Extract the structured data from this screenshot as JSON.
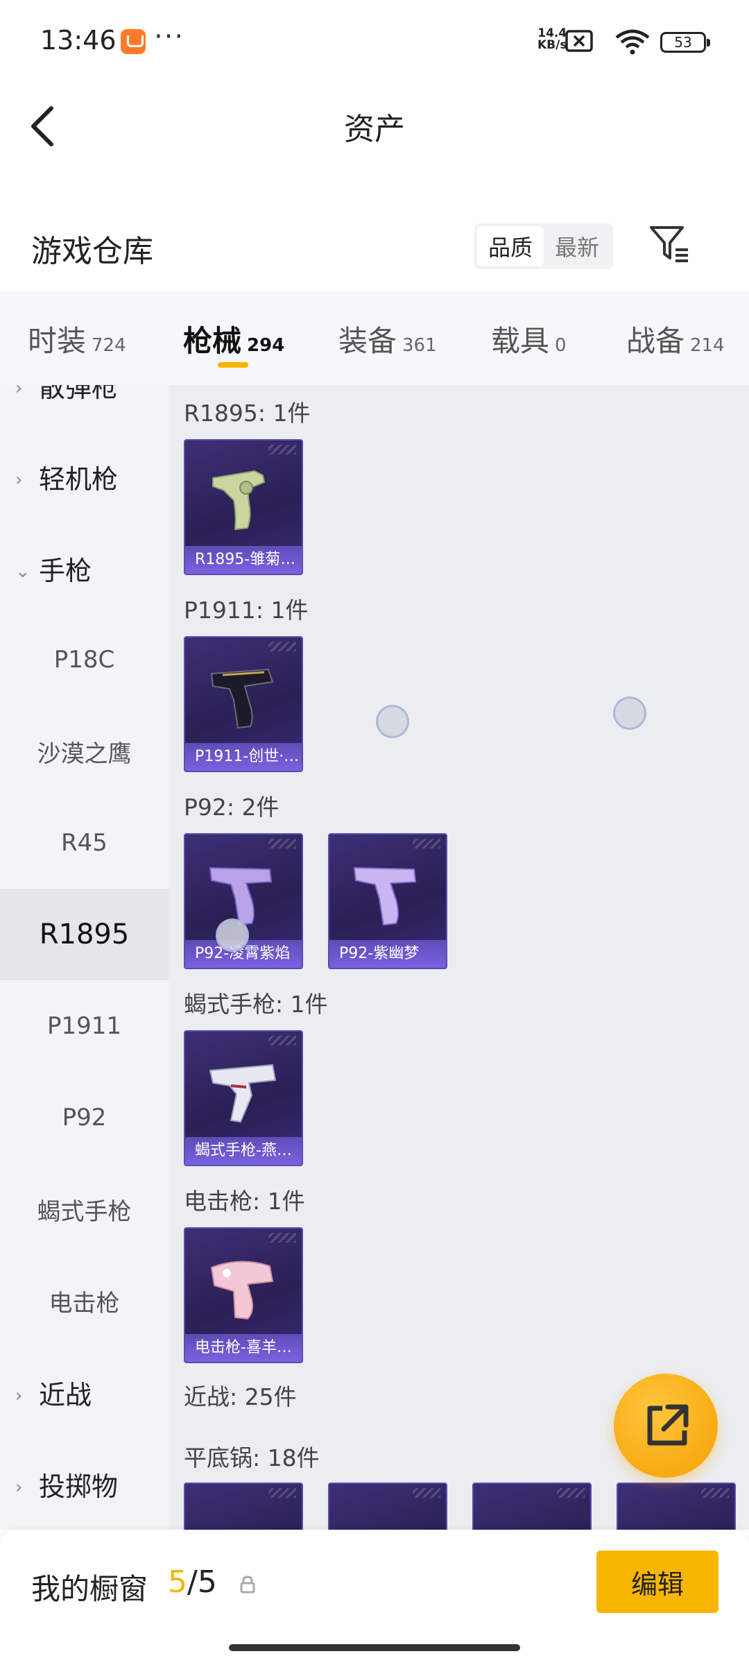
{
  "status_bar": {
    "time": "13:46",
    "dots": "···",
    "net_speed_value": "14.4",
    "net_speed_unit": "KB/s",
    "battery": "53",
    "icons": [
      "app-notification-icon",
      "no-sim-icon",
      "wifi-icon",
      "battery-icon"
    ]
  },
  "header": {
    "title": "资产",
    "back_icon": "back-arrow-icon"
  },
  "warehouse": {
    "title": "游戏仓库",
    "sort_options": [
      "品质",
      "最新"
    ],
    "selected_sort": "品质",
    "filter_icon": "filter-icon"
  },
  "tabs": [
    {
      "label": "时装",
      "count": "724"
    },
    {
      "label": "枪械",
      "count": "294"
    },
    {
      "label": "装备",
      "count": "361"
    },
    {
      "label": "载具",
      "count": "0"
    },
    {
      "label": "战备",
      "count": "214"
    }
  ],
  "active_tab": "枪械",
  "sidebar": {
    "items": [
      {
        "label": "散弹枪",
        "type": "group"
      },
      {
        "label": "轻机枪",
        "type": "group"
      },
      {
        "label": "手枪",
        "type": "group",
        "expanded": true
      },
      {
        "label": "P18C",
        "type": "sub"
      },
      {
        "label": "沙漠之鹰",
        "type": "sub"
      },
      {
        "label": "R45",
        "type": "sub"
      },
      {
        "label": "R1895",
        "type": "sub",
        "selected": true
      },
      {
        "label": "P1911",
        "type": "sub"
      },
      {
        "label": "P92",
        "type": "sub"
      },
      {
        "label": "蝎式手枪",
        "type": "sub"
      },
      {
        "label": "电击枪",
        "type": "sub"
      },
      {
        "label": "近战",
        "type": "group"
      },
      {
        "label": "投掷物",
        "type": "group"
      }
    ]
  },
  "sections": [
    {
      "title": "R1895: 1件",
      "items": [
        {
          "label": "R1895-雏菊…"
        }
      ]
    },
    {
      "title": "P1911: 1件",
      "items": [
        {
          "label": "P1911-创世·…"
        }
      ]
    },
    {
      "title": "P92: 2件",
      "items": [
        {
          "label": "P92-凌霄紫焰"
        },
        {
          "label": "P92-紫幽梦"
        }
      ]
    },
    {
      "title": "蝎式手枪: 1件",
      "items": [
        {
          "label": "蝎式手枪-燕…"
        }
      ]
    },
    {
      "title": "电击枪: 1件",
      "items": [
        {
          "label": "电击枪-喜羊…"
        }
      ]
    },
    {
      "title": "近战: 25件",
      "items": []
    },
    {
      "title": "平底锅: 18件",
      "items": []
    }
  ],
  "fab_icon": "share-icon",
  "bottom_bar": {
    "label": "我的橱窗",
    "used": "5",
    "separator": "/",
    "total": "5",
    "lock_icon": "lock-icon",
    "edit_label": "编辑"
  },
  "colors": {
    "accent": "#f5b400",
    "card_bg": "#2a2054",
    "card_label_bg": "#7d64e6",
    "sidebar_bg": "#f2f4f8",
    "content_bg": "#ebedf0"
  }
}
